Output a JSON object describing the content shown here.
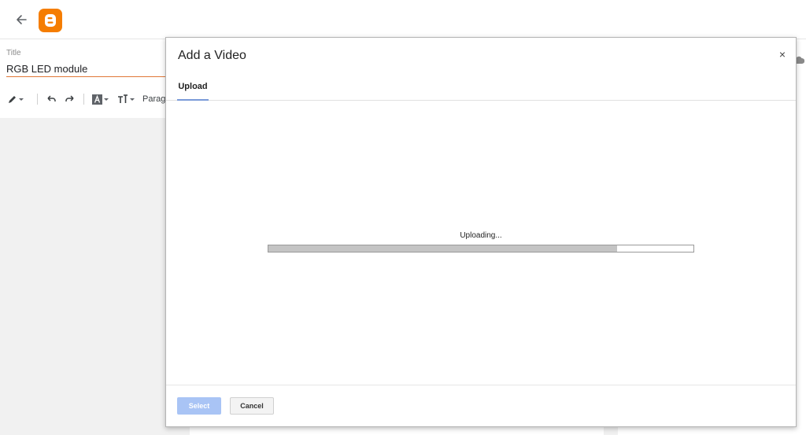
{
  "header": {
    "back_icon": "arrow-left-icon",
    "logo_icon": "blogger-logo-icon",
    "brand_color": "#f57d00"
  },
  "post": {
    "title_label": "Title",
    "title_value": "RGB LED module"
  },
  "toolbar": {
    "items": [
      {
        "icon": "pencil-icon",
        "has_dropdown": true
      },
      {
        "icon": "undo-icon"
      },
      {
        "icon": "redo-icon"
      },
      {
        "icon": "text-color-icon",
        "has_dropdown": true
      },
      {
        "icon": "font-size-icon",
        "has_dropdown": true
      }
    ],
    "paragraph_label": "Parag"
  },
  "dialog": {
    "title": "Add a Video",
    "close_label": "×",
    "tabs": [
      {
        "label": "Upload",
        "active": true
      }
    ],
    "status_text": "Uploading...",
    "progress": 0.82,
    "select_label": "Select",
    "cancel_label": "Cancel",
    "accent_color": "#7a9ad8"
  }
}
